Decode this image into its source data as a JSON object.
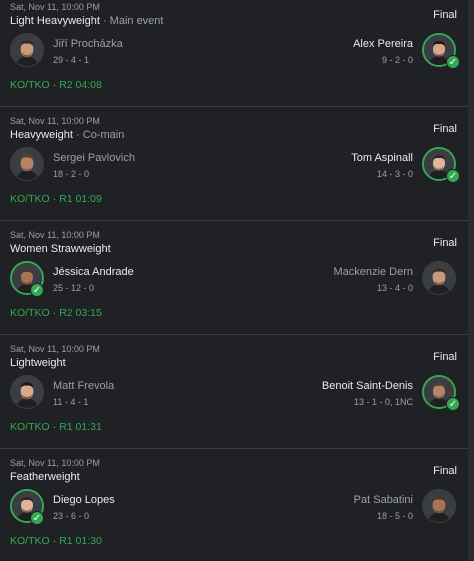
{
  "fights": [
    {
      "date": "Sat, Nov 11, 10:00 PM",
      "weight_class": "Light Heavyweight",
      "event_note": "Main event",
      "status": "Final",
      "left": {
        "name": "Jiří Procházka",
        "record": "29 - 4 - 1",
        "winner": false,
        "icon": "fighter-avatar-icon"
      },
      "right": {
        "name": "Alex Pereira",
        "record": "9 - 2 - 0",
        "winner": true,
        "icon": "fighter-avatar-icon"
      },
      "method": "KO/TKO",
      "round_time": "R2 04:08"
    },
    {
      "date": "Sat, Nov 11, 10:00 PM",
      "weight_class": "Heavyweight",
      "event_note": "Co-main",
      "status": "Final",
      "left": {
        "name": "Sergei Pavlovich",
        "record": "18 - 2 - 0",
        "winner": false,
        "icon": "fighter-avatar-icon"
      },
      "right": {
        "name": "Tom Aspinall",
        "record": "14 - 3 - 0",
        "winner": true,
        "icon": "fighter-avatar-icon"
      },
      "method": "KO/TKO",
      "round_time": "R1 01:09"
    },
    {
      "date": "Sat, Nov 11, 10:00 PM",
      "weight_class": "Women Strawweight",
      "event_note": "",
      "status": "Final",
      "left": {
        "name": "Jéssica Andrade",
        "record": "25 - 12 - 0",
        "winner": true,
        "icon": "fighter-avatar-icon"
      },
      "right": {
        "name": "Mackenzie Dern",
        "record": "13 - 4 - 0",
        "winner": false,
        "icon": "fighter-avatar-icon"
      },
      "method": "KO/TKO",
      "round_time": "R2 03:15"
    },
    {
      "date": "Sat, Nov 11, 10:00 PM",
      "weight_class": "Lightweight",
      "event_note": "",
      "status": "Final",
      "left": {
        "name": "Matt Frevola",
        "record": "11 - 4 - 1",
        "winner": false,
        "icon": "fighter-avatar-icon"
      },
      "right": {
        "name": "Benoit Saint-Denis",
        "record": "13 - 1 - 0, 1NC",
        "winner": true,
        "icon": "fighter-avatar-icon"
      },
      "method": "KO/TKO",
      "round_time": "R1 01:31"
    },
    {
      "date": "Sat, Nov 11, 10:00 PM",
      "weight_class": "Featherweight",
      "event_note": "",
      "status": "Final",
      "left": {
        "name": "Diego Lopes",
        "record": "23 - 6 - 0",
        "winner": true,
        "icon": "fighter-avatar-icon"
      },
      "right": {
        "name": "Pat Sabatini",
        "record": "18 - 5 - 0",
        "winner": false,
        "icon": "fighter-avatar-icon"
      },
      "method": "KO/TKO",
      "round_time": "R1 01:30"
    }
  ],
  "colors": {
    "background": "#202124",
    "win_green": "#34a853",
    "muted_text": "#9aa0a6",
    "divider": "#3c4043"
  }
}
